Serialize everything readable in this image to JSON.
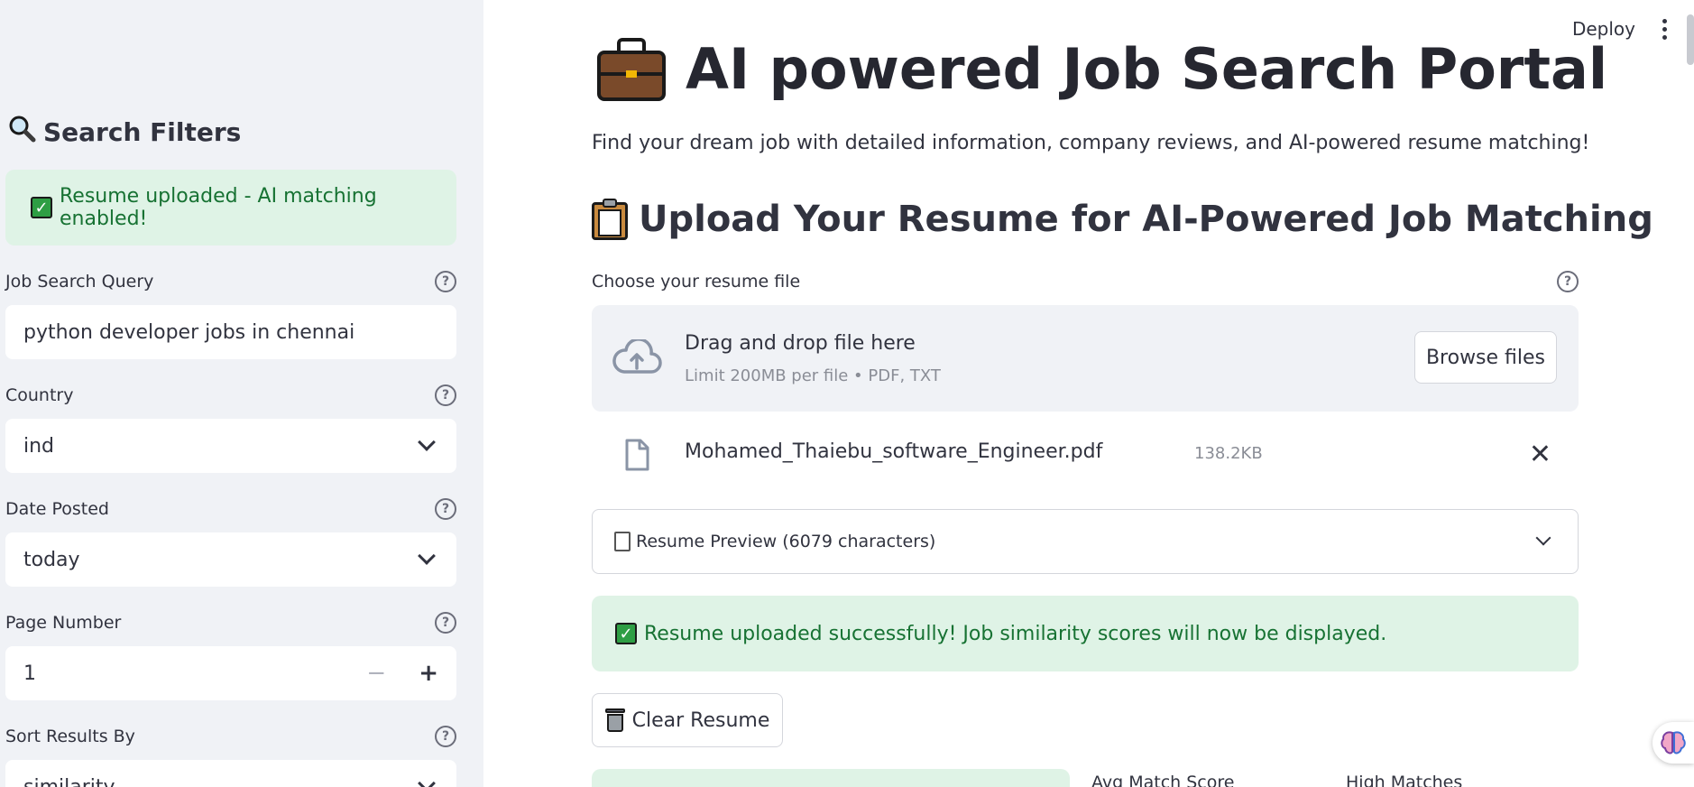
{
  "sidebar": {
    "title": "Search Filters",
    "title_icon": "magnifier-icon",
    "alert": "Resume uploaded - AI matching enabled!",
    "fields": [
      {
        "label": "Job Search Query",
        "value": "python developer jobs in chennai",
        "kind": "text"
      },
      {
        "label": "Country",
        "value": "ind",
        "kind": "select"
      },
      {
        "label": "Date Posted",
        "value": "today",
        "kind": "select"
      },
      {
        "label": "Page Number",
        "value": "1",
        "kind": "number",
        "minus": "−",
        "plus": "+"
      },
      {
        "label": "Sort Results By",
        "value": "similarity",
        "kind": "select"
      }
    ]
  },
  "header": {
    "deploy": "Deploy"
  },
  "main": {
    "title": "AI powered Job Search Portal",
    "subtitle": "Find your dream job with detailed information, company reviews, and AI-powered resume matching!",
    "upload_heading": "Upload Your Resume for AI-Powered Job Matching",
    "uploader": {
      "label": "Choose your resume file",
      "drop_title": "Drag and drop file here",
      "drop_sub": "Limit 200MB per file • PDF, TXT",
      "browse": "Browse files"
    },
    "file": {
      "name": "Mohamed_Thaiebu_software_Engineer.pdf",
      "size": "138.2KB"
    },
    "expander": "Resume Preview (6079 characters)",
    "success": "Resume uploaded successfully! Job similarity scores will now be displayed.",
    "clear_button": "Clear Resume",
    "metrics": [
      {
        "label": "Avg Match Score"
      },
      {
        "label": "High Matches"
      }
    ]
  },
  "colors": {
    "sidebar_bg": "#f0f2f6",
    "success_bg": "#dff3e6",
    "success_text": "#177233"
  }
}
